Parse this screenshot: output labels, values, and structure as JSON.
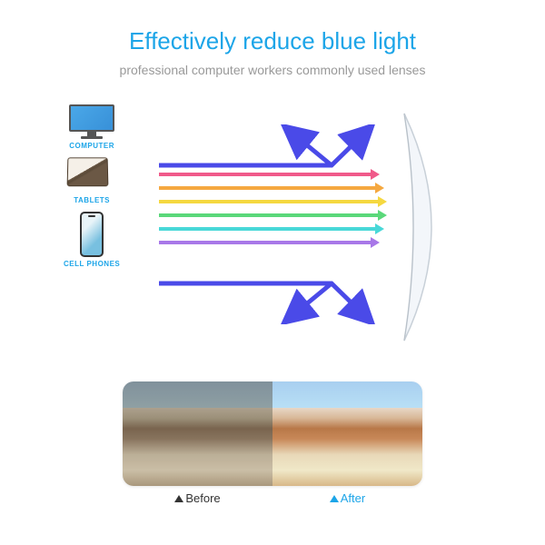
{
  "title": "Effectively reduce blue light",
  "subtitle": "professional computer workers commonly used lenses",
  "devices": {
    "computer": "COMPUTER",
    "tablets": "TABLETS",
    "phones": "CELL PHONES"
  },
  "comparison": {
    "before": "Before",
    "after": "After"
  },
  "colors": {
    "accent": "#1ca5e8",
    "rays": [
      "#4a4ae8",
      "#f05a8a",
      "#f5a840",
      "#f5d840",
      "#5ad87a",
      "#48d8d8",
      "#a878e8"
    ]
  }
}
